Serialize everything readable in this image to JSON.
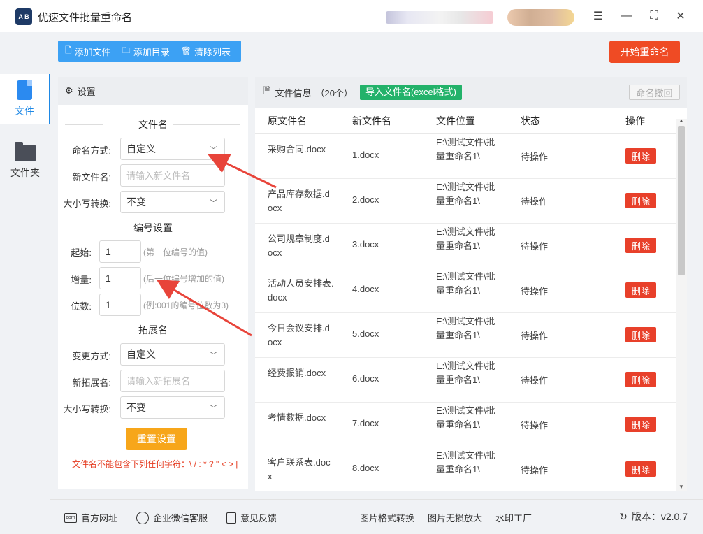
{
  "app": {
    "title": "优速文件批量重命名",
    "logo_text": "A B"
  },
  "window": {
    "menu_icon": "☰",
    "minimize_icon": "—",
    "maximize_icon": "⛶",
    "close_icon": "✕"
  },
  "toolbar": {
    "add_file": "添加文件",
    "add_dir": "添加目录",
    "clear_list": "清除列表",
    "start_rename": "开始重命名"
  },
  "nav": {
    "file": "文件",
    "folder": "文件夹"
  },
  "settings": {
    "header": "设置",
    "filename_section": "文件名",
    "naming_mode_label": "命名方式:",
    "naming_mode_value": "自定义",
    "new_name_label": "新文件名:",
    "new_name_placeholder": "请输入新文件名",
    "case_label": "大小写转换:",
    "case_value": "不变",
    "numbering_section": "编号设置",
    "start_label": "起始:",
    "start_value": "1",
    "start_hint": "(第一位编号的值)",
    "step_label": "增量:",
    "step_value": "1",
    "step_hint": "(后一位编号增加的值)",
    "digits_label": "位数:",
    "digits_value": "1",
    "digits_hint": "(例:001的编号位数为3)",
    "ext_section": "拓展名",
    "ext_mode_label": "变更方式:",
    "ext_mode_value": "自定义",
    "new_ext_label": "新拓展名:",
    "new_ext_placeholder": "请输入新拓展名",
    "ext_case_label": "大小写转换:",
    "ext_case_value": "不变",
    "reset_button": "重置设置",
    "warning": "文件名不能包含下列任何字符：\\ / : * ? \" < > |"
  },
  "file_info": {
    "header": "文件信息",
    "count": "（20个）",
    "import_button": "导入文件名(excel格式)",
    "undo_button": "命名撤回",
    "columns": {
      "original": "原文件名",
      "new": "新文件名",
      "location": "文件位置",
      "status": "状态",
      "action": "操作"
    },
    "rows": [
      {
        "original": "采购合同.docx",
        "new": "1.docx",
        "location": "E:\\测试文件\\批量重命名1\\",
        "status": "待操作",
        "action": "删除"
      },
      {
        "original": "产品库存数据.docx",
        "new": "2.docx",
        "location": "E:\\测试文件\\批量重命名1\\",
        "status": "待操作",
        "action": "删除"
      },
      {
        "original": "公司规章制度.docx",
        "new": "3.docx",
        "location": "E:\\测试文件\\批量重命名1\\",
        "status": "待操作",
        "action": "删除"
      },
      {
        "original": "活动人员安排表.docx",
        "new": "4.docx",
        "location": "E:\\测试文件\\批量重命名1\\",
        "status": "待操作",
        "action": "删除"
      },
      {
        "original": "今日会议安排.docx",
        "new": "5.docx",
        "location": "E:\\测试文件\\批量重命名1\\",
        "status": "待操作",
        "action": "删除"
      },
      {
        "original": "经费报销.docx",
        "new": "6.docx",
        "location": "E:\\测试文件\\批量重命名1\\",
        "status": "待操作",
        "action": "删除"
      },
      {
        "original": "考情数据.docx",
        "new": "7.docx",
        "location": "E:\\测试文件\\批量重命名1\\",
        "status": "待操作",
        "action": "删除"
      },
      {
        "original": "客户联系表.docx",
        "new": "8.docx",
        "location": "E:\\测试文件\\批量重命名1\\",
        "status": "待操作",
        "action": "删除"
      }
    ]
  },
  "footer": {
    "website": "官方网址",
    "wechat": "企业微信客服",
    "feedback": "意见反馈",
    "img_convert": "图片格式转换",
    "img_enlarge": "图片无损放大",
    "watermark": "水印工厂",
    "version": "版本：v2.0.7"
  },
  "colors": {
    "accent_blue": "#3ca1f4",
    "start_red": "#ef4b24",
    "import_green": "#23b26a",
    "reset_orange": "#f7a61a",
    "arrow_red": "#e8443a"
  }
}
